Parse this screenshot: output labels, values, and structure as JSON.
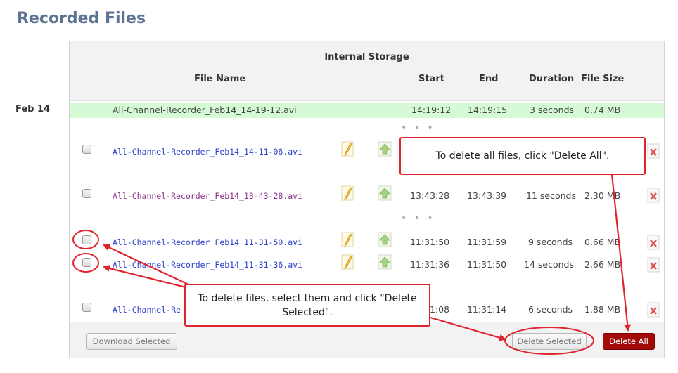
{
  "page": {
    "title": "Recorded Files"
  },
  "storage": {
    "label": "Internal Storage"
  },
  "columns": {
    "file_name": "File Name",
    "start": "Start",
    "end": "End",
    "duration": "Duration",
    "file_size": "File Size"
  },
  "date_group": "Feb 14",
  "in_progress": {
    "name": "All-Channel-Recorder_Feb14_14-19-12.avi",
    "start": "14:19:12",
    "end": "14:19:15",
    "duration": "3 seconds",
    "size": "0.74 MB"
  },
  "ellipsis": "• • •",
  "rows": [
    {
      "name": "All-Channel-Recorder_Feb14_14-11-06.avi",
      "start": "",
      "end": "",
      "duration": "",
      "size": ""
    },
    {
      "name": "All-Channel-Recorder_Feb14_13-43-28.avi",
      "start": "13:43:28",
      "end": "13:43:39",
      "duration": "11 seconds",
      "size": "2.30 MB"
    },
    {
      "name": "All-Channel-Recorder_Feb14_11-31-50.avi",
      "start": "11:31:50",
      "end": "11:31:59",
      "duration": "9 seconds",
      "size": "0.66 MB"
    },
    {
      "name": "All-Channel-Recorder_Feb14_11-31-36.avi",
      "start": "11:31:36",
      "end": "11:31:50",
      "duration": "14 seconds",
      "size": "2.66 MB"
    },
    {
      "name_visible": "All-Channel-Re",
      "start_visible": "1:08",
      "end": "11:31:14",
      "duration": "6 seconds",
      "size": "1.88 MB"
    }
  ],
  "buttons": {
    "download_selected": "Download Selected",
    "delete_selected": "Delete Selected",
    "delete_all": "Delete All"
  },
  "callouts": {
    "delete_all": "To delete all files, click \"Delete All\".",
    "delete_selected_line1": "To delete files, select them and click \"Delete",
    "delete_selected_line2": "Selected\"."
  },
  "colors": {
    "title": "#5f7493",
    "annotation_red": "#e0242e",
    "delete_all_bg": "#a30b0b",
    "in_progress_bg": "#d5fad5",
    "link_blue": "#2b3fcc",
    "link_visited": "#8a2f8a"
  }
}
